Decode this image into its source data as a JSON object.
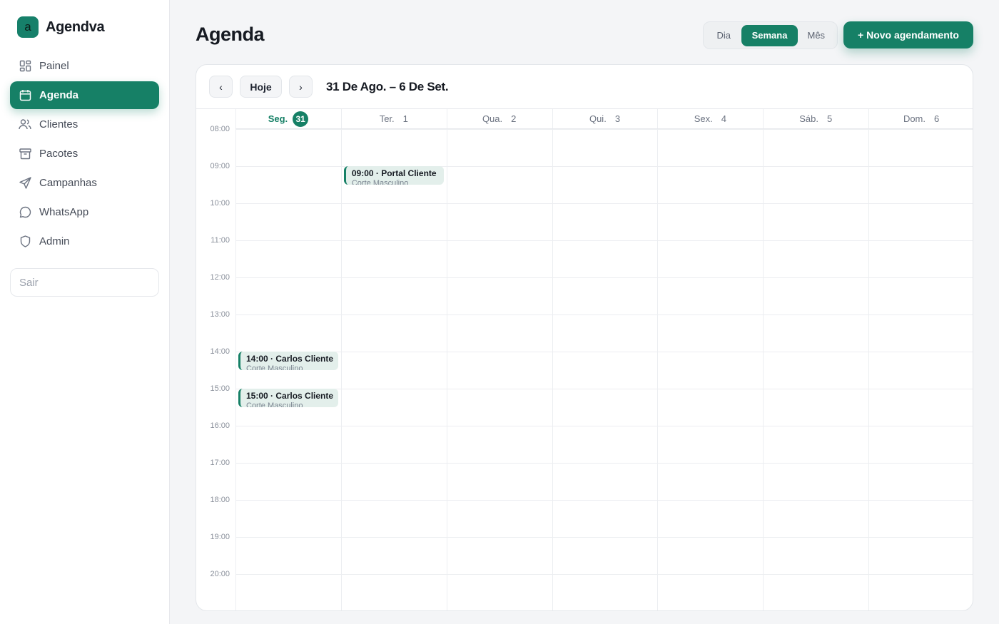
{
  "brand": {
    "logo_letter": "a",
    "name": "Agendva"
  },
  "sidebar": {
    "items": [
      {
        "label": "Painel",
        "icon": "dashboard-icon",
        "active": false
      },
      {
        "label": "Agenda",
        "icon": "calendar-icon",
        "active": true
      },
      {
        "label": "Clientes",
        "icon": "users-icon",
        "active": false
      },
      {
        "label": "Pacotes",
        "icon": "package-icon",
        "active": false
      },
      {
        "label": "Campanhas",
        "icon": "send-icon",
        "active": false
      },
      {
        "label": "WhatsApp",
        "icon": "chat-icon",
        "active": false
      },
      {
        "label": "Admin",
        "icon": "shield-icon",
        "active": false
      }
    ],
    "logout_label": "Sair"
  },
  "header": {
    "title": "Agenda",
    "views": {
      "day": "Dia",
      "week": "Semana",
      "month": "Mês",
      "selected": "Semana"
    },
    "new_button": "+ Novo agendamento"
  },
  "calendar": {
    "prev": "‹",
    "today": "Hoje",
    "next": "›",
    "range": "31 De Ago. – 6 De Set.",
    "days": [
      {
        "name": "Seg.",
        "num": "31",
        "today": true
      },
      {
        "name": "Ter.",
        "num": "1",
        "today": false
      },
      {
        "name": "Qua.",
        "num": "2",
        "today": false
      },
      {
        "name": "Qui.",
        "num": "3",
        "today": false
      },
      {
        "name": "Sex.",
        "num": "4",
        "today": false
      },
      {
        "name": "Sáb.",
        "num": "5",
        "today": false
      },
      {
        "name": "Dom.",
        "num": "6",
        "today": false
      }
    ],
    "hours": [
      "08:00",
      "09:00",
      "10:00",
      "11:00",
      "12:00",
      "13:00",
      "14:00",
      "15:00",
      "16:00",
      "17:00",
      "18:00",
      "19:00",
      "20:00"
    ],
    "events": [
      {
        "day": 1,
        "hour": "09:00",
        "title": "09:00 · Portal Cliente",
        "subtitle": "Corte Masculino"
      },
      {
        "day": 0,
        "hour": "14:00",
        "title": "14:00 · Carlos Cliente",
        "subtitle": "Corte Masculino"
      },
      {
        "day": 0,
        "hour": "15:00",
        "title": "15:00 · Carlos Cliente",
        "subtitle": "Corte Masculino"
      }
    ]
  },
  "colors": {
    "accent": "#168066",
    "event_bg": "#e3efeb",
    "background": "#f4f5f7"
  }
}
